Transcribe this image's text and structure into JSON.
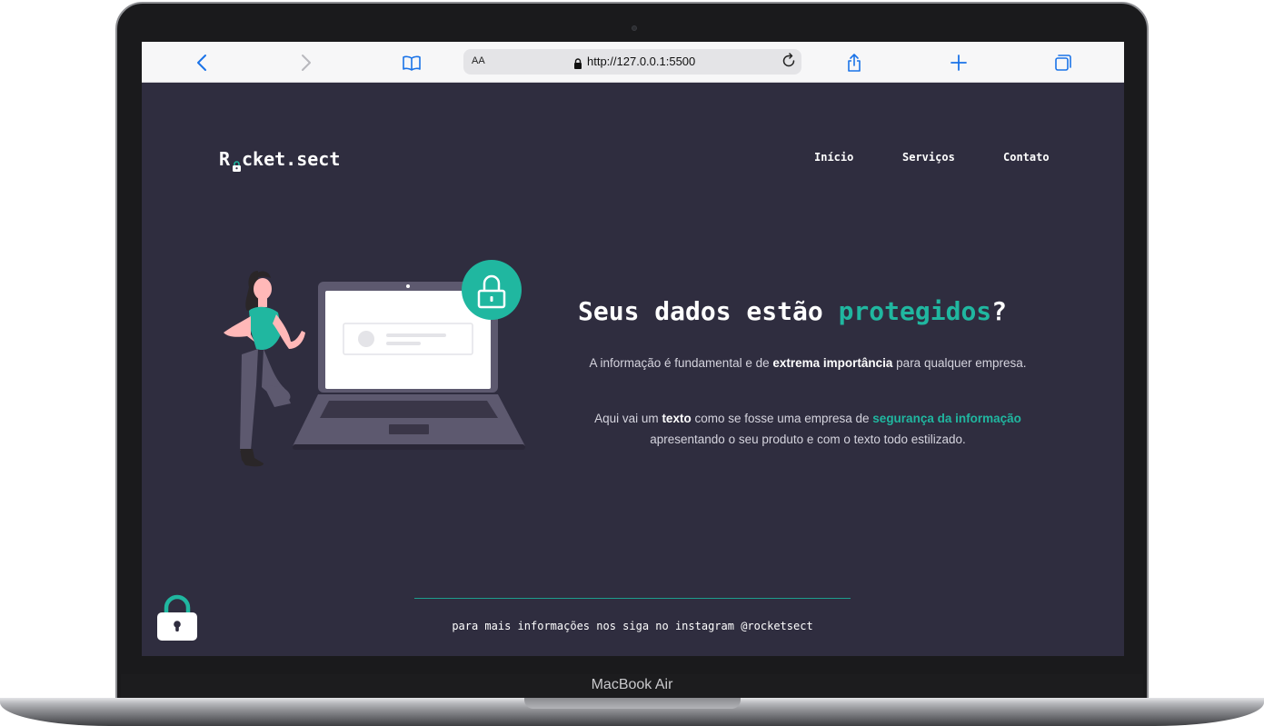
{
  "device": {
    "label": "MacBook Air"
  },
  "browser": {
    "text_size_label": "AA",
    "url": "http://127.0.0.1:5500",
    "icons": [
      "back-icon",
      "forward-icon",
      "bookmarks-icon",
      "lock-icon",
      "reload-icon",
      "share-icon",
      "new-tab-icon",
      "tabs-icon"
    ]
  },
  "site": {
    "logo": {
      "first_letter": "R",
      "rest": "cket.sect"
    },
    "nav": [
      "Início",
      "Serviços",
      "Contato"
    ],
    "hero": {
      "title_start": "Seus dados estão ",
      "title_highlight": "protegidos",
      "title_end": "?",
      "p1_start": "A informação é fundamental e de ",
      "p1_bold": "extrema importância",
      "p1_end": " para qualquer empresa.",
      "p2_start": "Aqui vai um ",
      "p2_bold": "texto",
      "p2_mid": " como se fosse uma empresa de ",
      "p2_highlight": "segurança da informação",
      "p2_end": " apresentando o seu produto e com o texto todo estilizado."
    },
    "footer": {
      "text": "para mais informações nos siga no instagram @rocketsect"
    }
  },
  "colors": {
    "background": "#2f2d3f",
    "accent": "#20b7a0",
    "text": "#ffffff",
    "muted_text": "#d5d4de"
  }
}
